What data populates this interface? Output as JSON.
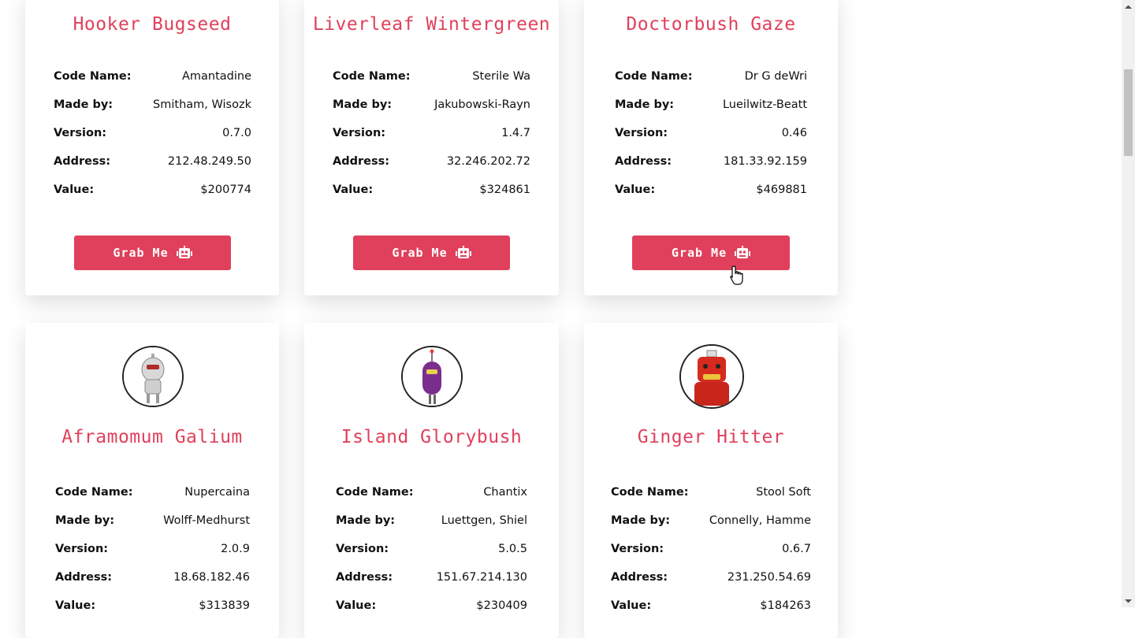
{
  "row1": [
    {
      "name": "Hooker Bugseed",
      "code_name": "Amantadine",
      "made_by": "Smitham, Wisozk",
      "version": "0.7.0",
      "address": "212.48.249.50",
      "value": "$200774"
    },
    {
      "name": "Liverleaf Wintergreen",
      "code_name": "Sterile Wa",
      "made_by": "Jakubowski-Rayn",
      "version": "1.4.7",
      "address": "32.246.202.72",
      "value": "$324861"
    },
    {
      "name": "Doctorbush Gaze",
      "code_name": "Dr G deWri",
      "made_by": "Lueilwitz-Beatt",
      "version": "0.46",
      "address": "181.33.92.159",
      "value": "$469881"
    }
  ],
  "row2": [
    {
      "name": "Aframomum Galium",
      "code_name": "Nupercaina",
      "made_by": "Wolff-Medhurst",
      "version": "2.0.9",
      "address": "18.68.182.46",
      "value": "$313839"
    },
    {
      "name": "Island Glorybush",
      "code_name": "Chantix",
      "made_by": "Luettgen, Shiel",
      "version": "5.0.5",
      "address": "151.67.214.130",
      "value": "$230409"
    },
    {
      "name": "Ginger Hitter",
      "code_name": "Stool Soft",
      "made_by": "Connelly, Hamme",
      "version": "0.6.7",
      "address": "231.250.54.69",
      "value": "$184263"
    }
  ],
  "labels": {
    "code_name": "Code Name:",
    "made_by": "Made by:",
    "version": "Version:",
    "address": "Address:",
    "value": "Value:"
  },
  "button_label": "Grab Me",
  "icons": {
    "button_icon": "robot-icon",
    "cursor": "hand-pointer-cursor-icon"
  },
  "colors": {
    "accent": "#e0405b"
  }
}
